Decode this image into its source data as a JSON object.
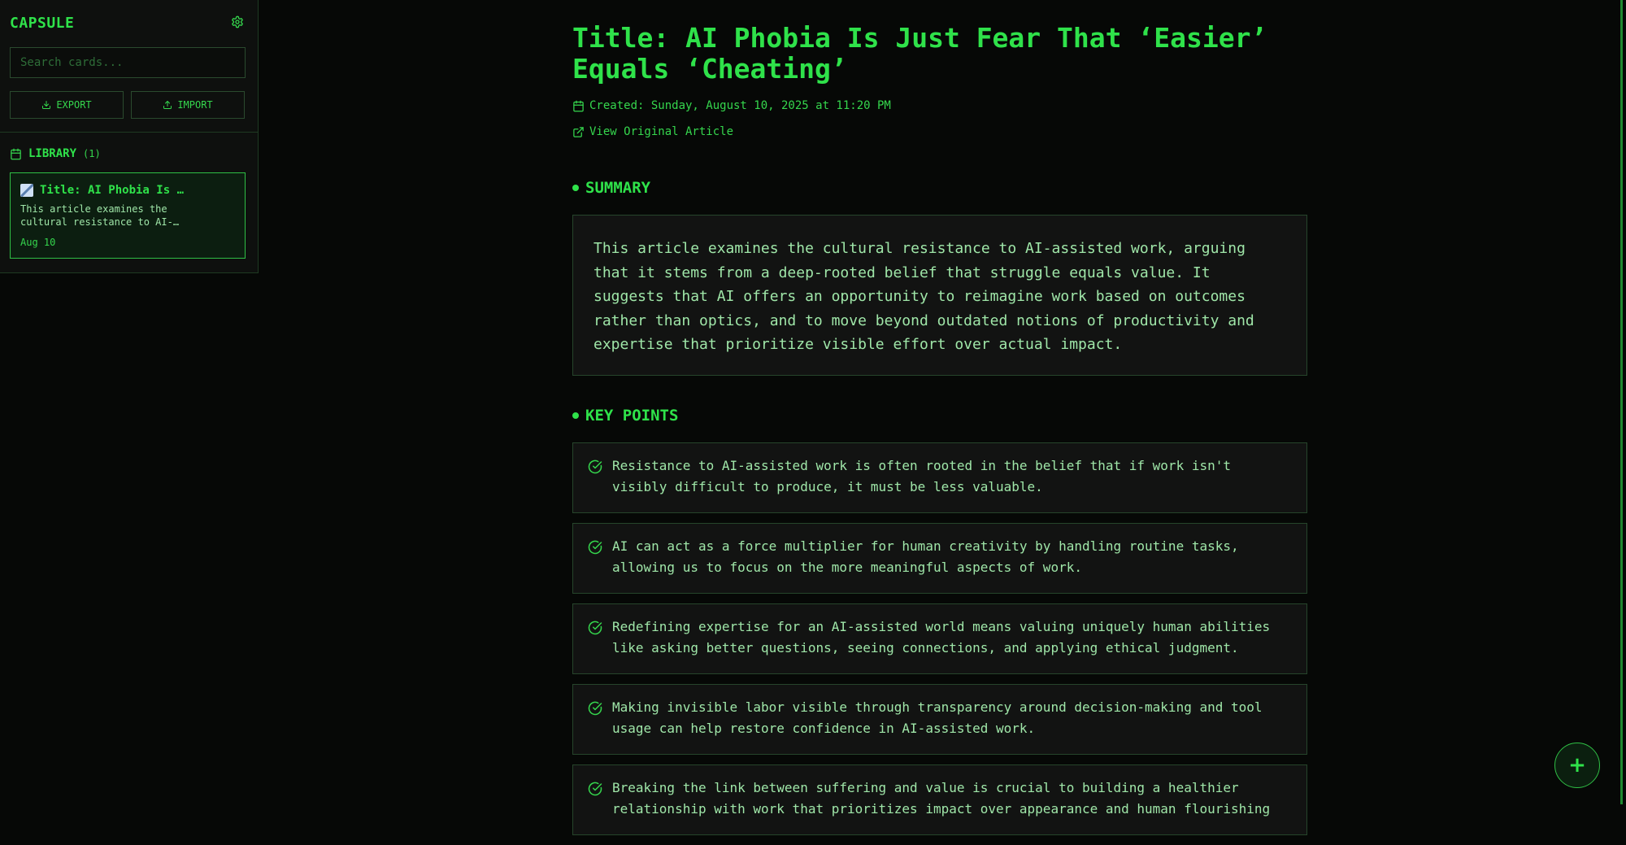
{
  "sidebar": {
    "brand": "CAPSULE",
    "search_placeholder": "Search cards...",
    "export_label": "EXPORT",
    "import_label": "IMPORT",
    "library_label": "LIBRARY",
    "library_count": "(1)",
    "cards": [
      {
        "title": "Title: AI Phobia Is …",
        "description": "This article examines the\ncultural resistance to AI-…",
        "date": "Aug 10"
      }
    ]
  },
  "article": {
    "title": "Title: AI Phobia Is Just Fear That ‘Easier’ Equals ‘Cheating’",
    "created": "Created: Sunday, August 10, 2025 at 11:20 PM",
    "view_original": "View Original Article",
    "summary_heading": "SUMMARY",
    "summary": "This article examines the cultural resistance to AI-assisted work, arguing that it stems from a deep-rooted belief that struggle equals value. It suggests that AI offers an opportunity to reimagine work based on outcomes rather than optics, and to move beyond outdated notions of productivity and expertise that prioritize visible effort over actual impact.",
    "key_points_heading": "KEY POINTS",
    "key_points": [
      "Resistance to AI-assisted work is often rooted in the belief that if work isn't visibly difficult to produce, it must be less valuable.",
      "AI can act as a force multiplier for human creativity by handling routine tasks, allowing us to focus on the more meaningful aspects of work.",
      "Redefining expertise for an AI-assisted world means valuing uniquely human abilities like asking better questions, seeing connections, and applying ethical judgment.",
      "Making invisible labor visible through transparency around decision-making and tool usage can help restore confidence in AI-assisted work.",
      "Breaking the link between suffering and value is crucial to building a healthier relationship with work that prioritizes impact over appearance and human flourishing"
    ]
  },
  "fab": {
    "label": "+"
  },
  "colors": {
    "accent": "#2fe24a",
    "text_soft": "#9fe6a8",
    "background": "#060806",
    "panel": "#121312",
    "border": "#26452b"
  },
  "icons": {
    "settings": "gear-icon",
    "export": "download-icon",
    "import": "upload-icon",
    "library": "calendar-icon",
    "created": "calendar-icon",
    "view_original": "external-link-icon",
    "key_point": "check-circle-icon",
    "fab": "plus-icon"
  }
}
